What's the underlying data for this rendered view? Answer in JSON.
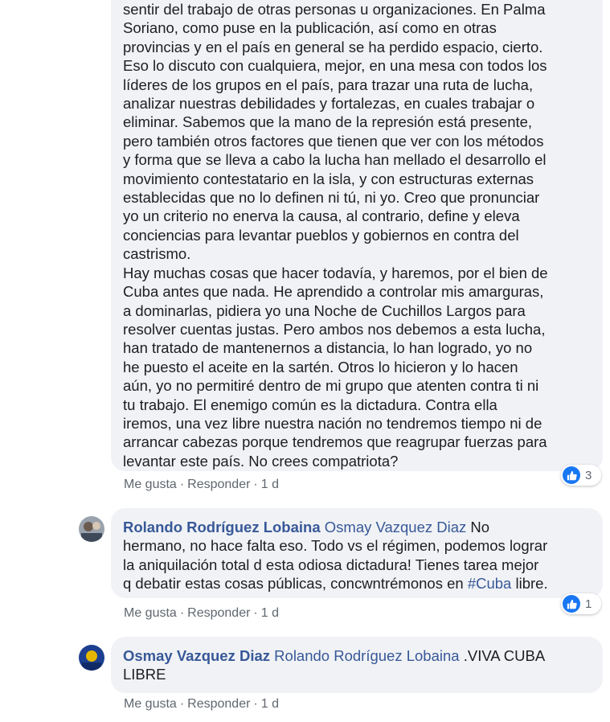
{
  "comments": [
    {
      "text": "sentir del trabajo de otras personas u organizaciones. En Palma Soriano, como puse en la publicación, así como en otras\nprovincias y en el país en general se ha perdido espacio, cierto.\nEso lo discuto con cualquiera, mejor, en una mesa con todos los\nlíderes de los grupos en el país, para trazar una ruta de lucha,\nanalizar nuestras debilidades y fortalezas, en cuales trabajar o\neliminar. Sabemos que la mano de la represión está presente,\npero también otros factores que tienen que ver con los métodos\ny forma que se lleva a cabo la lucha han mellado el desarrollo el\nmovimiento contestatario en la isla, y con estructuras externas\nestablecidas que no lo definen ni tú, ni yo. Creo que pronunciar\nyo un criterio no enerva la causa, al contrario, define y eleva\nconciencias para levantar pueblos y gobiernos en contra del\ncastrismo.\nHay muchas cosas que hacer todavía, y haremos, por el bien de\nCuba antes que nada. He aprendido a controlar mis amarguras,\na dominarlas, pidiera yo una Noche de Cuchillos Largos para\nresolver cuentas justas. Pero ambos nos debemos a esta lucha,\nhan tratado de mantenernos a distancia, lo han logrado, yo no\nhe puesto el aceite en la sartén. Otros lo hicieron y lo hacen\naún, yo no permitiré dentro de mi grupo que atenten contra ti ni\ntu trabajo. El enemigo común es la dictadura. Contra ella\niremos, una vez libre nuestra nación no tendremos tiempo ni de\narrancar cabezas porque tendremos que reagrupar fuerzas para\nlevantar este país. No crees compatriota?",
      "like_label": "Me gusta",
      "reply_label": "Responder",
      "sep": "·",
      "time": "1 d",
      "reaction_count": "3"
    },
    {
      "author": "Rolando Rodríguez Lobaina",
      "mention": "Osmay Vazquez Diaz",
      "text_before": " No\nhermano, no hace falta eso. Todo vs el régimen, podemos lograr\nla aniquilación total d esta odiosa dictadura! Tienes tarea mejor\nq debatir estas cosas públicas, concwntrémonos en ",
      "hashtag": "#Cuba",
      "text_after": " libre.",
      "like_label": "Me gusta",
      "reply_label": "Responder",
      "sep": "·",
      "time": "1 d",
      "reaction_count": "1"
    },
    {
      "author": "Osmay Vazquez Diaz",
      "mention": "Rolando Rodríguez Lobaina",
      "text": " .VIVA CUBA\nLIBRE",
      "like_label": "Me gusta",
      "reply_label": "Responder",
      "sep": "·",
      "time": "1 d"
    }
  ],
  "icons": {
    "like": "thumbs-up-icon",
    "avatar1": "user-avatar",
    "avatar2": "user-avatar"
  },
  "colors": {
    "link": "#385898",
    "bubble": "#f0f2f5",
    "like_blue": "#1877f2",
    "meta": "#606770"
  }
}
